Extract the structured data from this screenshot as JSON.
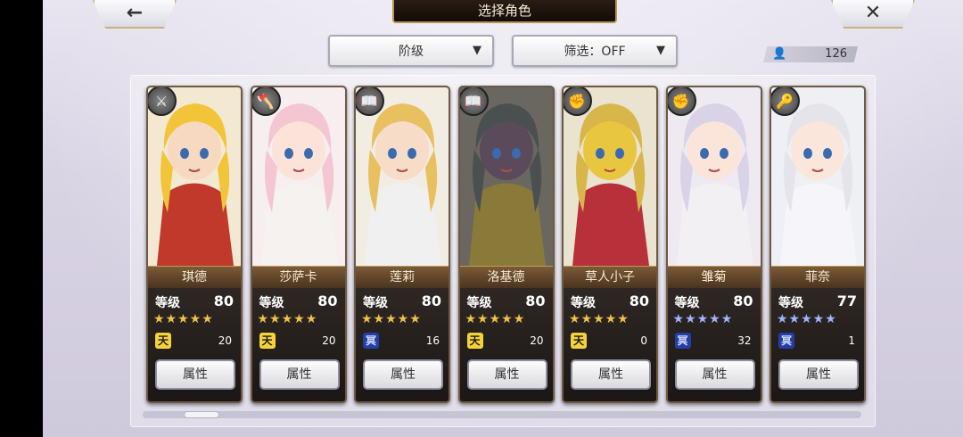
{
  "header": {
    "title": "选择角色",
    "back_icon": "←",
    "close_icon": "✕"
  },
  "filters": {
    "sort_label": "阶级",
    "filter_label": "筛选：OFF"
  },
  "roster": {
    "count": "126"
  },
  "stat_label": "等级",
  "attr_label": "属性",
  "characters": [
    {
      "name": "琪德",
      "level": "80",
      "stars": "★★★★★",
      "star_color": "gold",
      "rank_glyph": "天",
      "rank_color": "gold",
      "rank_value": "20",
      "role_icon": "sword-icon",
      "hair": "#f2c43a",
      "skin": "#f7d8c0",
      "outfit": "#c0392b",
      "bg": "#f3e9d2"
    },
    {
      "name": "莎萨卡",
      "level": "80",
      "stars": "★★★★★",
      "star_color": "gold",
      "rank_glyph": "天",
      "rank_color": "gold",
      "rank_value": "20",
      "role_icon": "axe-icon",
      "hair": "#f3c6d2",
      "skin": "#fbe3d9",
      "outfit": "#f5f2f0",
      "bg": "#f7eef0"
    },
    {
      "name": "莲莉",
      "level": "80",
      "stars": "★★★★★",
      "star_color": "gold",
      "rank_glyph": "冥",
      "rank_color": "blue",
      "rank_value": "16",
      "role_icon": "book-icon",
      "hair": "#e9c060",
      "skin": "#f7dcc8",
      "outfit": "#f0f0f0",
      "bg": "#f2ede3"
    },
    {
      "name": "洛基德",
      "level": "80",
      "stars": "★★★★★",
      "star_color": "gold",
      "rank_glyph": "天",
      "rank_color": "gold",
      "rank_value": "20",
      "role_icon": "book-icon",
      "hair": "#4a4f50",
      "skin": "#5a4a5a",
      "outfit": "#8a7a3a",
      "bg": "#6a6660"
    },
    {
      "name": "草人小子",
      "level": "80",
      "stars": "★★★★★",
      "star_color": "gold",
      "rank_glyph": "天",
      "rank_color": "gold",
      "rank_value": "0",
      "role_icon": "fist-icon",
      "hair": "#d9b64a",
      "skin": "#e8c640",
      "outfit": "#b8303a",
      "bg": "#e9e3cf"
    },
    {
      "name": "雏菊",
      "level": "80",
      "stars": "★★★★★",
      "star_color": "blue",
      "rank_glyph": "冥",
      "rank_color": "blue",
      "rank_value": "32",
      "role_icon": "fist-icon",
      "hair": "#d8d3e6",
      "skin": "#fbe4da",
      "outfit": "#f3f0f4",
      "bg": "#efe9f1"
    },
    {
      "name": "菲奈",
      "level": "77",
      "stars": "★★★★★",
      "star_color": "blue",
      "rank_glyph": "冥",
      "rank_color": "blue",
      "rank_value": "1",
      "role_icon": "key-icon",
      "hair": "#e4e4ea",
      "skin": "#fbe6dc",
      "outfit": "#f6f6fa",
      "bg": "#eef0f4"
    }
  ]
}
